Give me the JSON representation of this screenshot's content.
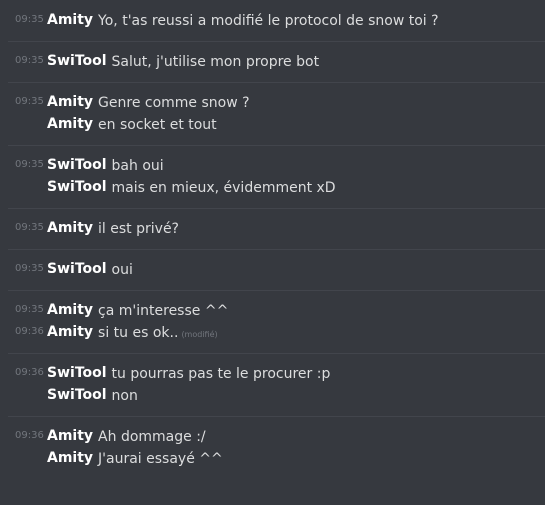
{
  "groups": [
    {
      "lines": [
        {
          "time": "09:35",
          "author": "Amity",
          "text": "Yo, t'as reussi a modifié le protocol de snow toi ?"
        }
      ]
    },
    {
      "lines": [
        {
          "time": "09:35",
          "author": "SwiTool",
          "text": "Salut, j'utilise mon propre bot"
        }
      ]
    },
    {
      "lines": [
        {
          "time": "09:35",
          "author": "Amity",
          "text": "Genre comme snow ?"
        },
        {
          "time": "",
          "author": "Amity",
          "text": "en socket et tout"
        }
      ]
    },
    {
      "lines": [
        {
          "time": "09:35",
          "author": "SwiTool",
          "text": "bah oui"
        },
        {
          "time": "",
          "author": "SwiTool",
          "text": "mais en mieux, évidemment xD"
        }
      ]
    },
    {
      "lines": [
        {
          "time": "09:35",
          "author": "Amity",
          "text": "il est privé?"
        }
      ]
    },
    {
      "lines": [
        {
          "time": "09:35",
          "author": "SwiTool",
          "text": "oui"
        }
      ]
    },
    {
      "lines": [
        {
          "time": "09:35",
          "author": "Amity",
          "text": "ça m'interesse ^^"
        },
        {
          "time": "09:36",
          "author": "Amity",
          "text": "si tu es ok..",
          "edited": "(modifié)"
        }
      ]
    },
    {
      "lines": [
        {
          "time": "09:36",
          "author": "SwiTool",
          "text": "tu pourras pas te le procurer :p"
        },
        {
          "time": "",
          "author": "SwiTool",
          "text": "non"
        }
      ]
    },
    {
      "lines": [
        {
          "time": "09:36",
          "author": "Amity",
          "text": "Ah dommage :/"
        },
        {
          "time": "",
          "author": "Amity",
          "text": "J'aurai essayé ^^"
        }
      ]
    }
  ]
}
